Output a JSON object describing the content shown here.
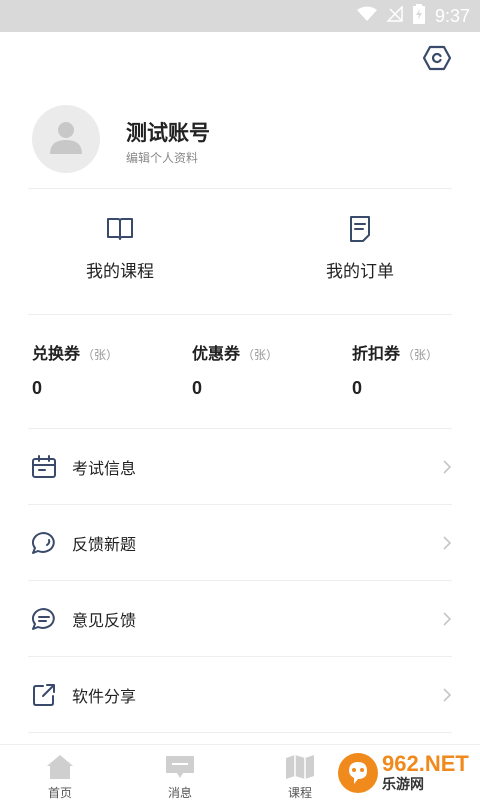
{
  "status_bar": {
    "time": "9:37",
    "icons": [
      "wifi-icon",
      "signal-off-icon",
      "battery-charging-icon"
    ]
  },
  "header": {
    "settings_icon": "hexagon-settings-icon"
  },
  "profile": {
    "name": "测试账号",
    "edit_label": "编辑个人资料",
    "avatar_icon": "user-avatar-icon"
  },
  "quick_links": [
    {
      "label": "我的课程",
      "icon": "open-book-icon"
    },
    {
      "label": "我的订单",
      "icon": "document-icon"
    }
  ],
  "coupons": [
    {
      "title": "兑换券",
      "unit": "（张）",
      "value": "0"
    },
    {
      "title": "优惠券",
      "unit": "（张）",
      "value": "0"
    },
    {
      "title": "折扣券",
      "unit": "（张）",
      "value": "0"
    }
  ],
  "menu": [
    {
      "label": "考试信息",
      "icon": "calendar-icon"
    },
    {
      "label": "反馈新题",
      "icon": "chat-bubble-icon"
    },
    {
      "label": "意见反馈",
      "icon": "message-lines-icon"
    },
    {
      "label": "软件分享",
      "icon": "share-external-icon"
    }
  ],
  "tabs": [
    {
      "label": "首页",
      "icon": "home-icon"
    },
    {
      "label": "消息",
      "icon": "message-icon"
    },
    {
      "label": "课程",
      "icon": "map-book-icon"
    },
    {
      "label": "",
      "icon": "profile-tab-icon"
    }
  ],
  "watermark": {
    "main": "962.NET",
    "sub": "乐游网"
  },
  "colors": {
    "accent": "#3a4a6b",
    "status_bar": "#d9d9d9",
    "watermark_orange": "#f08a1c"
  }
}
